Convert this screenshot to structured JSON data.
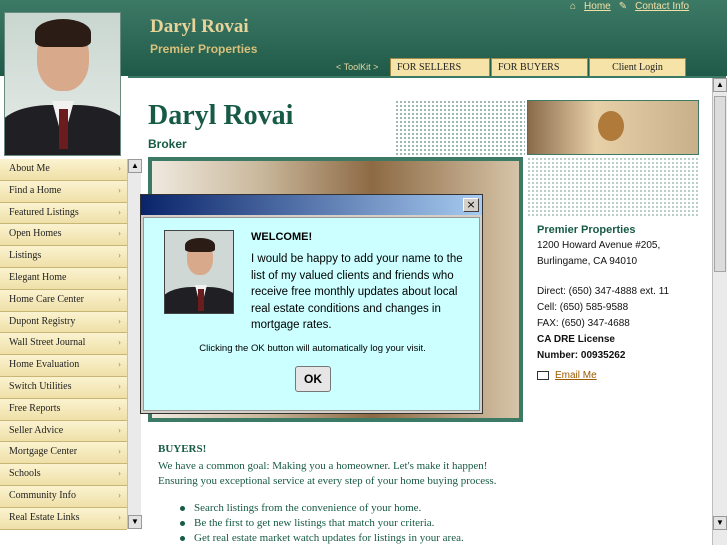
{
  "header": {
    "name": "Daryl Rovai",
    "company": "Premier Properties",
    "links": [
      "Home",
      "Contact Info"
    ],
    "toolkit": "< ToolKit >"
  },
  "nav_tabs": [
    "FOR SELLERS",
    "FOR BUYERS",
    "Client Login"
  ],
  "sidebar": {
    "items": [
      "About Me",
      "Find a Home",
      "Featured Listings",
      "Open Homes",
      "Listings",
      "Elegant Home",
      "Home Care Center",
      "Dupont Registry",
      "Wall Street Journal",
      "Home Evaluation",
      "Switch Utilities",
      "Free Reports",
      "Seller Advice",
      "Mortgage Center",
      "Schools",
      "Community Info",
      "Real Estate Links"
    ]
  },
  "main": {
    "name": "Daryl Rovai",
    "title": "Broker"
  },
  "contact": {
    "company": "Premier Properties",
    "address1": "1200 Howard Avenue #205,",
    "address2": "Burlingame, CA 94010",
    "direct": "Direct: (650) 347-4888 ext. 11",
    "cell": "Cell: (650) 585-9588",
    "fax": "FAX: (650) 347-4688",
    "license_label": "CA DRE License",
    "license_number": "Number: 00935262",
    "email": "Email Me"
  },
  "buyers": {
    "heading": "BUYERS!",
    "line1": "We have a common goal: Making you a homeowner. Let's make it happen!",
    "line2": "Ensuring you exceptional service at every step of your home buying process.",
    "bullets": [
      "Search listings from the convenience of your home.",
      "Be the first to get new listings that match your criteria.",
      "Get real estate market watch updates for listings in your area."
    ]
  },
  "dialog": {
    "close": "×",
    "welcome": "WELCOME!",
    "message": "I would be happy to add your name to the list of my valued clients and friends who receive free monthly updates about local real estate conditions and changes in mortgage rates.",
    "note": "Clicking the OK button will automatically log your visit.",
    "ok": "OK"
  }
}
